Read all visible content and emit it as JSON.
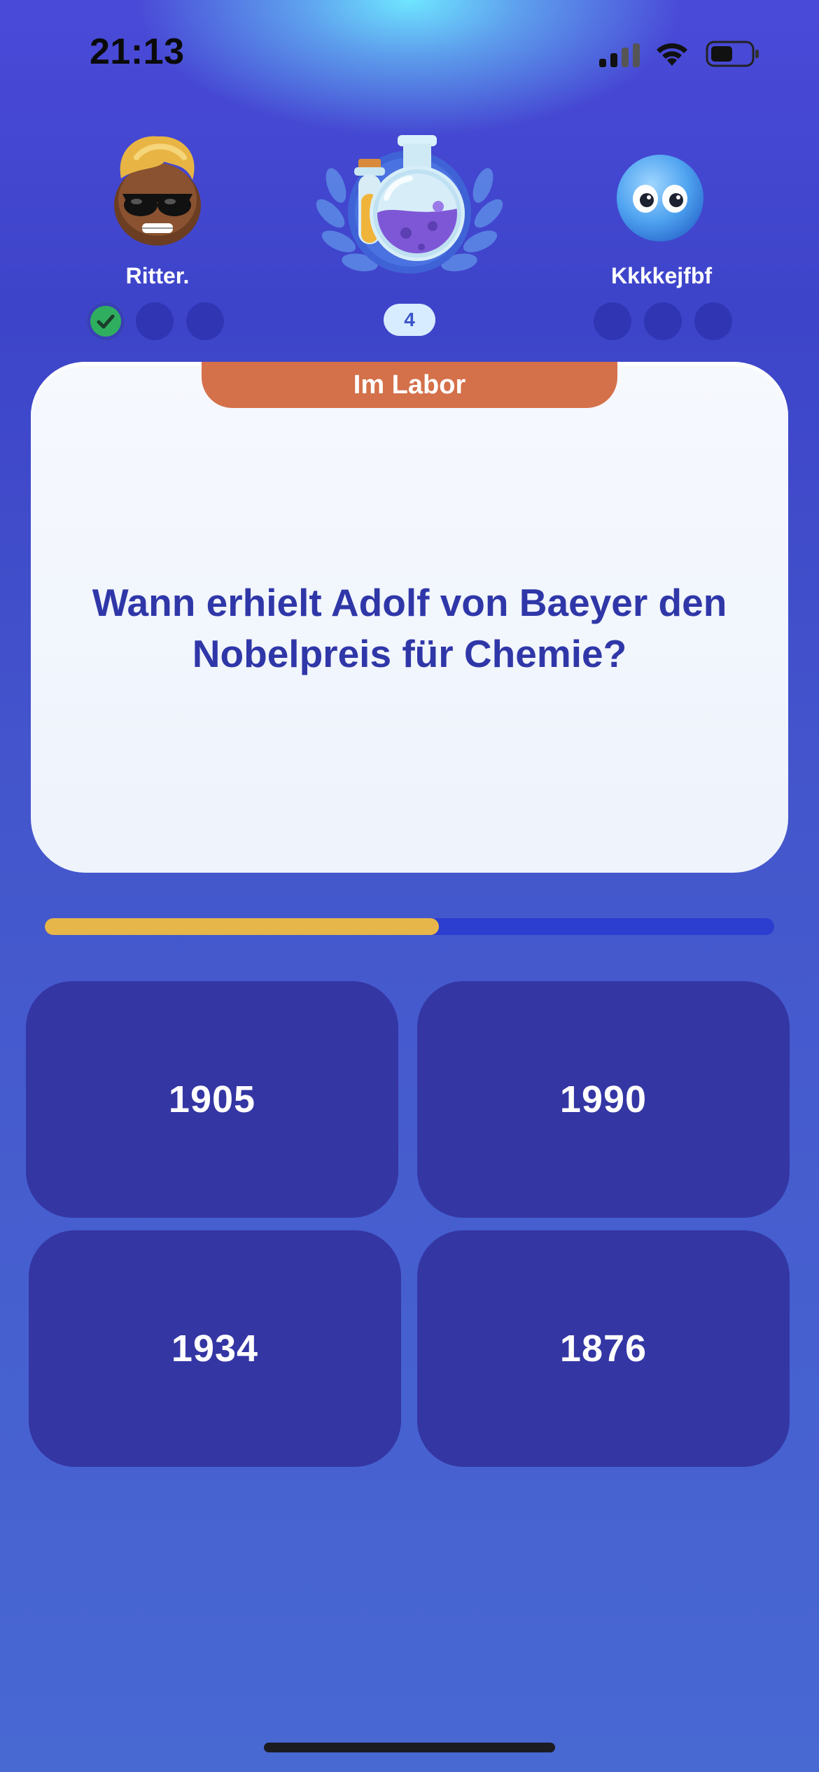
{
  "status_bar": {
    "time": "21:13",
    "icons": [
      "signal-icon",
      "wifi-icon",
      "battery-icon"
    ]
  },
  "players": {
    "left": {
      "name": "Ritter.",
      "avatar": "sunglasses-emoji-avatar",
      "results": [
        "correct",
        "pending",
        "pending"
      ]
    },
    "right": {
      "name": "Kkkkejfbf",
      "avatar": "blue-blob-eyes-avatar",
      "results": [
        "pending",
        "pending",
        "pending"
      ]
    }
  },
  "round": {
    "category_icon": "chemistry-flask-icon",
    "number": "4"
  },
  "question_card": {
    "category": "Im Labor",
    "question": "Wann erhielt Adolf von Baeyer den Nobelpreis für Chemie?"
  },
  "timer": {
    "remaining_fraction": 0.54
  },
  "answers": [
    "1905",
    "1990",
    "1934",
    "1876"
  ],
  "colors": {
    "category_tab": "#d4704a",
    "answer_button": "#3436a4",
    "timer_fill": "#e6b64a",
    "question_text": "#2f37a8",
    "correct_dot": "#2fae5f"
  }
}
